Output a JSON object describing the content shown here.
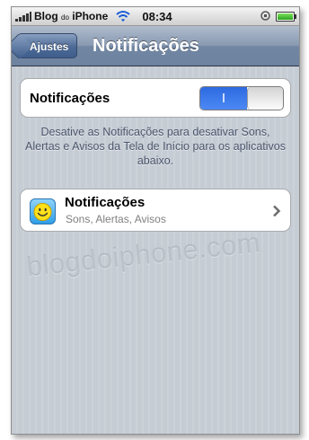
{
  "status_bar": {
    "carrier_main": "Blog",
    "carrier_small": "do",
    "carrier_end": "iPhone",
    "time": "08:34",
    "battery_level": 1.0,
    "colors": {
      "battery": "#2aa31e"
    }
  },
  "nav_bar": {
    "back_label": "Ajustes",
    "title": "Notificações"
  },
  "notifications_toggle": {
    "label": "Notificações",
    "on_glyph": "I",
    "state": "on",
    "colors": {
      "on": "#2d6ae0"
    }
  },
  "description": "Desative as Notificações para desativar Sons, Alertas e Avisos da Tela de Início para os aplicativos abaixo.",
  "app_row": {
    "title": "Notificações",
    "subtitle": "Sons, Alertas, Avisos",
    "icon": "smiley-face-icon"
  },
  "watermark": "blogdoiphone.com"
}
